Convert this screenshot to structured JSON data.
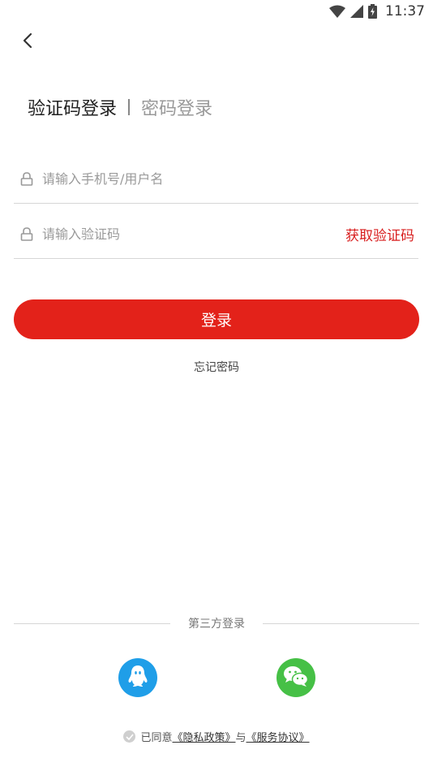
{
  "status_bar": {
    "time": "11:37",
    "icons": [
      "wifi-icon",
      "signal-icon",
      "battery-charging-icon"
    ]
  },
  "header": {
    "back_icon": "chevron-left-icon"
  },
  "tabs": {
    "active": "验证码登录",
    "inactive": "密码登录"
  },
  "form": {
    "phone_placeholder": "请输入手机号/用户名",
    "code_placeholder": "请输入验证码",
    "get_code_label": "获取验证码",
    "field_icon": "lock-icon"
  },
  "login_button": "登录",
  "forgot_password": "忘记密码",
  "third_party": {
    "title": "第三方登录",
    "providers": [
      "qq-icon",
      "wechat-icon"
    ]
  },
  "agreement": {
    "prefix": "已同意",
    "privacy": "《隐私政策》",
    "conjunction": "与",
    "service": "《服务协议》"
  },
  "colors": {
    "accent": "#e3221a",
    "link_red": "#d81e1e",
    "qq": "#1f9ee8",
    "wechat": "#46c046"
  }
}
